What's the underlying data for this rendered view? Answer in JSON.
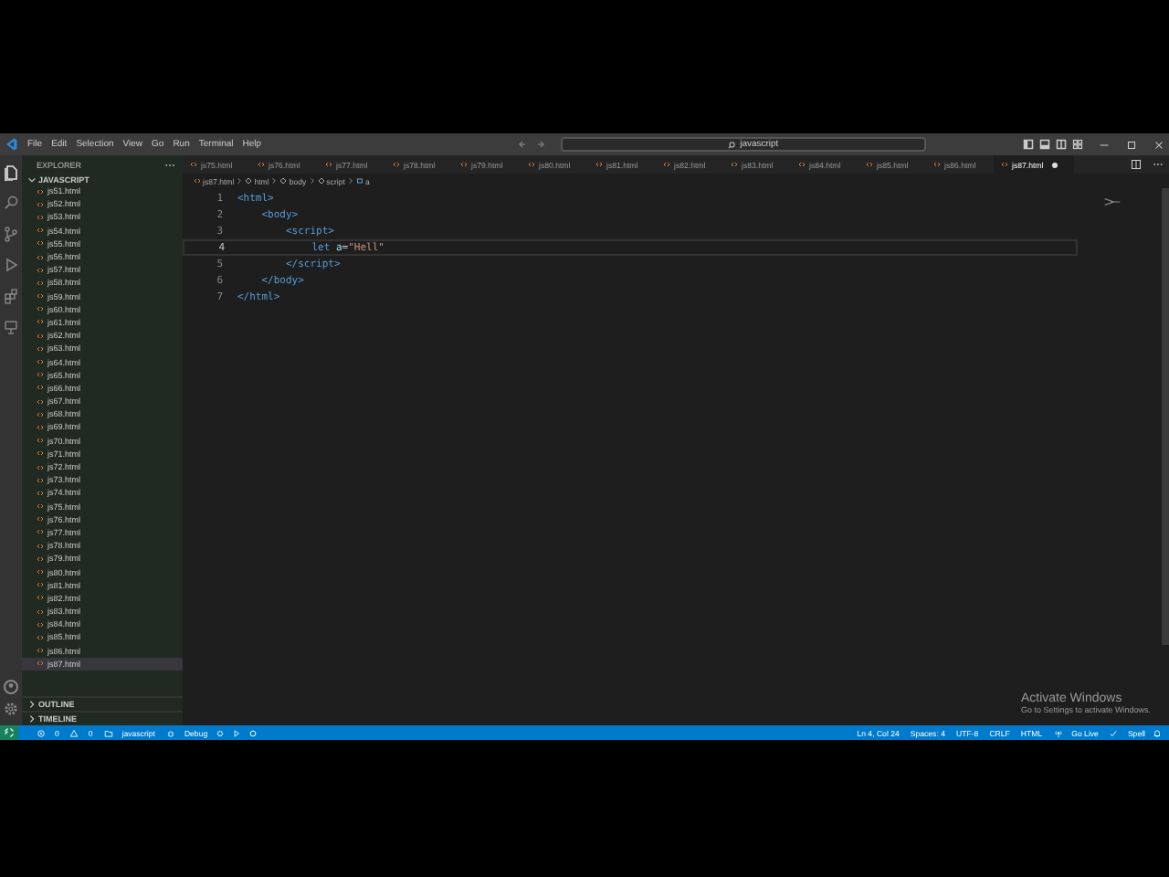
{
  "menu": [
    "File",
    "Edit",
    "Selection",
    "View",
    "Go",
    "Run",
    "Terminal",
    "Help"
  ],
  "command_center": {
    "value": "javascript"
  },
  "activity_bar": [
    {
      "kind": "files",
      "selected": true
    },
    {
      "kind": "search",
      "selected": false
    },
    {
      "kind": "branch",
      "selected": false
    },
    {
      "kind": "debug",
      "selected": false
    },
    {
      "kind": "extensions",
      "selected": false
    },
    {
      "kind": "remote",
      "selected": false
    }
  ],
  "sidebar": {
    "title": "EXPLORER",
    "folder": "JAVASCRIPT",
    "files": [
      {
        "name": "js51.html",
        "selected": false
      },
      {
        "name": "js52.html",
        "selected": false
      },
      {
        "name": "js53.html",
        "selected": false
      },
      {
        "name": "js54.html",
        "selected": false
      },
      {
        "name": "js55.html",
        "selected": false
      },
      {
        "name": "js56.html",
        "selected": false
      },
      {
        "name": "js57.html",
        "selected": false
      },
      {
        "name": "js58.html",
        "selected": false
      },
      {
        "name": "js59.html",
        "selected": false
      },
      {
        "name": "js60.html",
        "selected": false
      },
      {
        "name": "js61.html",
        "selected": false
      },
      {
        "name": "js62.html",
        "selected": false
      },
      {
        "name": "js63.html",
        "selected": false
      },
      {
        "name": "js64.html",
        "selected": false
      },
      {
        "name": "js65.html",
        "selected": false
      },
      {
        "name": "js66.html",
        "selected": false
      },
      {
        "name": "js67.html",
        "selected": false
      },
      {
        "name": "js68.html",
        "selected": false
      },
      {
        "name": "js69.html",
        "selected": false
      },
      {
        "name": "js70.html",
        "selected": false
      },
      {
        "name": "js71.html",
        "selected": false
      },
      {
        "name": "js72.html",
        "selected": false
      },
      {
        "name": "js73.html",
        "selected": false
      },
      {
        "name": "js74.html",
        "selected": false
      },
      {
        "name": "js75.html",
        "selected": false
      },
      {
        "name": "js76.html",
        "selected": false
      },
      {
        "name": "js77.html",
        "selected": false
      },
      {
        "name": "js78.html",
        "selected": false
      },
      {
        "name": "js79.html",
        "selected": false
      },
      {
        "name": "js80.html",
        "selected": false
      },
      {
        "name": "js81.html",
        "selected": false
      },
      {
        "name": "js82.html",
        "selected": false
      },
      {
        "name": "js83.html",
        "selected": false
      },
      {
        "name": "js84.html",
        "selected": false
      },
      {
        "name": "js85.html",
        "selected": false
      },
      {
        "name": "js86.html",
        "selected": false
      },
      {
        "name": "js87.html",
        "selected": true
      }
    ],
    "sections": [
      "OUTLINE",
      "TIMELINE"
    ]
  },
  "tabs": [
    {
      "label": "js75.html",
      "selected": false,
      "modified": false
    },
    {
      "label": "js76.html",
      "selected": false,
      "modified": false
    },
    {
      "label": "js77.html",
      "selected": false,
      "modified": false
    },
    {
      "label": "js78.html",
      "selected": false,
      "modified": false
    },
    {
      "label": "js79.html",
      "selected": false,
      "modified": false
    },
    {
      "label": "js80.html",
      "selected": false,
      "modified": false
    },
    {
      "label": "js81.html",
      "selected": false,
      "modified": false
    },
    {
      "label": "js82.html",
      "selected": false,
      "modified": false
    },
    {
      "label": "js83.html",
      "selected": false,
      "modified": false
    },
    {
      "label": "js84.html",
      "selected": false,
      "modified": false
    },
    {
      "label": "js85.html",
      "selected": false,
      "modified": false
    },
    {
      "label": "js86.html",
      "selected": false,
      "modified": false
    },
    {
      "label": "js87.html",
      "selected": true,
      "modified": true
    }
  ],
  "breadcrumb": [
    "js87.html",
    "html",
    "body",
    "script",
    "a"
  ],
  "code": [
    {
      "number": "1",
      "current": false,
      "tokens": [
        {
          "kind": "tag",
          "text": "<html>"
        }
      ]
    },
    {
      "number": "2",
      "current": false,
      "tokens": [
        {
          "kind": "tag",
          "text": "    <body>"
        }
      ]
    },
    {
      "number": "3",
      "current": false,
      "tokens": [
        {
          "kind": "tag",
          "text": "        <script>"
        }
      ]
    },
    {
      "number": "4",
      "current": true,
      "tokens": [
        {
          "kind": "keyword",
          "text": "            let "
        },
        {
          "kind": "variable",
          "text": "a"
        },
        {
          "kind": "plain",
          "text": "="
        },
        {
          "kind": "string",
          "text": "\"Hell\""
        }
      ]
    },
    {
      "number": "5",
      "current": false,
      "tokens": [
        {
          "kind": "tag",
          "text": "        </script>"
        }
      ]
    },
    {
      "number": "6",
      "current": false,
      "tokens": [
        {
          "kind": "tag",
          "text": "    </body>"
        }
      ]
    },
    {
      "number": "7",
      "current": false,
      "tokens": [
        {
          "kind": "tag",
          "text": "</html>"
        }
      ]
    }
  ],
  "activation": {
    "title": "Activate Windows",
    "message": "Go to Settings to activate Windows."
  },
  "status_left": [
    {
      "kind": "errors",
      "text": "0"
    },
    {
      "kind": "warnings",
      "text": "0"
    },
    {
      "kind": "folder",
      "text": "javascript"
    },
    {
      "kind": "debug",
      "text": "Debug"
    }
  ],
  "status_right": [
    {
      "kind": "plain",
      "text": "Ln 4, Col 24"
    },
    {
      "kind": "plain",
      "text": "Spaces: 4"
    },
    {
      "kind": "plain",
      "text": "UTF-8"
    },
    {
      "kind": "plain",
      "text": "CRLF"
    },
    {
      "kind": "plain",
      "text": "HTML"
    },
    {
      "kind": "live",
      "text": "Go Live"
    },
    {
      "kind": "spell",
      "text": "Spell"
    }
  ]
}
